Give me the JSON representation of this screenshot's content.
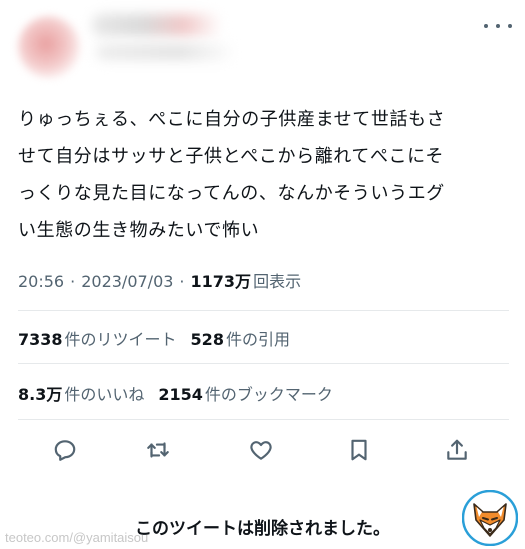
{
  "header": {
    "avatar": "blurred-avatar",
    "more_icon": "more-horizontal-icon"
  },
  "tweet": {
    "text": "りゅっちぇる、ぺこに自分の子供産ませて世話もさ\nせて自分はサッサと子供とぺこから離れてぺこにそ\nっくりな見た目になってんの、なんかそういうエグ\nい生態の生き物みたいで怖い"
  },
  "meta": {
    "time": "20:56",
    "sep1": "·",
    "date": "2023/07/03",
    "sep2": "·",
    "views_count": "1173万",
    "views_label": "回表示"
  },
  "stats": {
    "retweets_count": "7338",
    "retweets_label": "件のリツイート",
    "quotes_count": "528",
    "quotes_label": "件の引用",
    "likes_count": "8.3万",
    "likes_label": "件のいいね",
    "bookmarks_count": "2154",
    "bookmarks_label": "件のブックマーク"
  },
  "actions": [
    "reply-icon",
    "retweet-icon",
    "like-icon",
    "bookmark-icon",
    "share-icon"
  ],
  "notice": "このツイートは削除されました。",
  "watermark": "teoteo.com/@yamitaisou",
  "colors": {
    "text": "#0f1419",
    "secondary": "#536471",
    "divider": "#e6e9eb"
  }
}
